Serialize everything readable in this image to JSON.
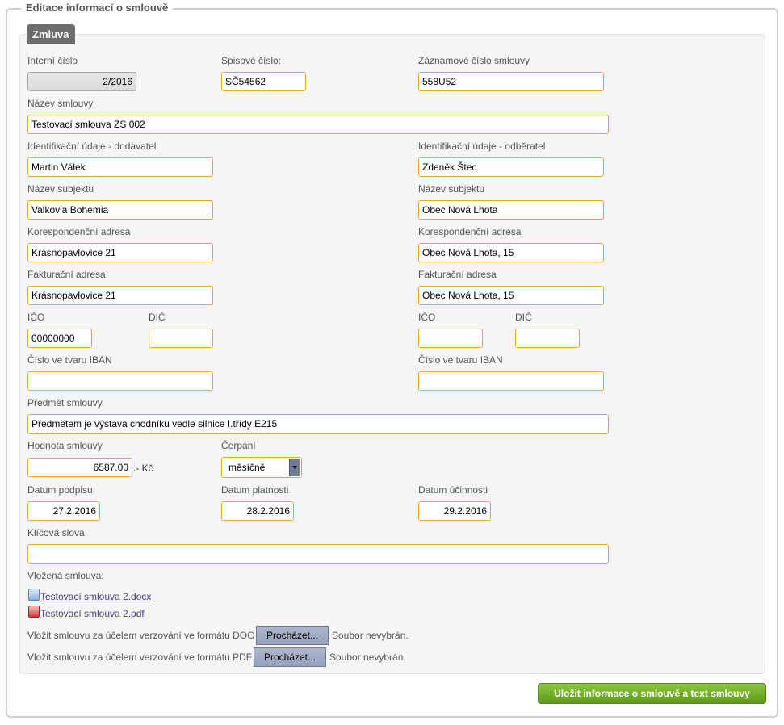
{
  "fieldset_title": "Editace informací o smlouvě",
  "tab_label": "Zmluva",
  "labels": {
    "interni_cislo": "Interní číslo",
    "spisove_cislo": "Spisové číslo:",
    "zaznamove_cislo": "Záznamové číslo smlouvy",
    "nazev_smlouvy": "Název smlouvy",
    "ident_dodavatel": "Identifikační údaje - dodavatel",
    "ident_odberatel": "Identifikační údaje - odběratel",
    "nazev_subjektu": "Název subjektu",
    "koresp_adresa": "Korespondenční adresa",
    "fakt_adresa": "Fakturační adresa",
    "ico": "IČO",
    "dic": "DIČ",
    "iban": "Číslo ve tvaru IBAN",
    "predmet": "Předmět smlouvy",
    "hodnota": "Hodnota smlouvy",
    "cerpani": "Čerpání",
    "currency": ".- Kč",
    "datum_podpisu": "Datum podpisu",
    "datum_platnosti": "Datum platnosti",
    "datum_ucinnosti": "Datum účinnosti",
    "klicova_slova": "Klíčová slova",
    "vlozena": "Vložená smlouva:",
    "upload_doc": "Vložit smlouvu za účelem verzování ve formátu DOC",
    "upload_pdf": "Vložit smlouvu za účelem verzování ve formátu PDF",
    "no_file": "Soubor nevybrán."
  },
  "values": {
    "interni_cislo": "2/2016",
    "spisove_cislo": "SČ54562",
    "zaznamove_cislo": "558U52",
    "nazev_smlouvy": "Testovací smlouva ZS 002",
    "dodavatel": {
      "ident": "Martin Válek",
      "nazev": "Valkovia Bohemia",
      "koresp": "Krásnopavlovice 21",
      "fakt": "Krásnopavlovice 21",
      "ico": "00000000",
      "dic": "",
      "iban": ""
    },
    "odberatel": {
      "ident": "Zdeněk Štec",
      "nazev": "Obec Nová Lhota",
      "koresp": "Obec Nová Lhota, 15",
      "fakt": "Obec Nová Lhota, 15",
      "ico": "",
      "dic": "",
      "iban": ""
    },
    "predmet": "Předmětem je výstava chodníku vedle silnice I.třídy E215",
    "hodnota": "6587.00",
    "cerpani": "měsíčně",
    "datum_podpisu": "27.2.2016",
    "datum_platnosti": "28.2.2016",
    "datum_ucinnosti": "29.2.2016",
    "klicova_slova": ""
  },
  "files": {
    "docx": "Testovací smlouva 2.docx",
    "pdf": "Testovací smlouva 2.pdf"
  },
  "buttons": {
    "browse": "Procházet...",
    "save": "Uložit informace o smlouvě a text smlouvy"
  },
  "icons": {
    "docx": "word-document-icon",
    "pdf": "pdf-document-icon"
  }
}
